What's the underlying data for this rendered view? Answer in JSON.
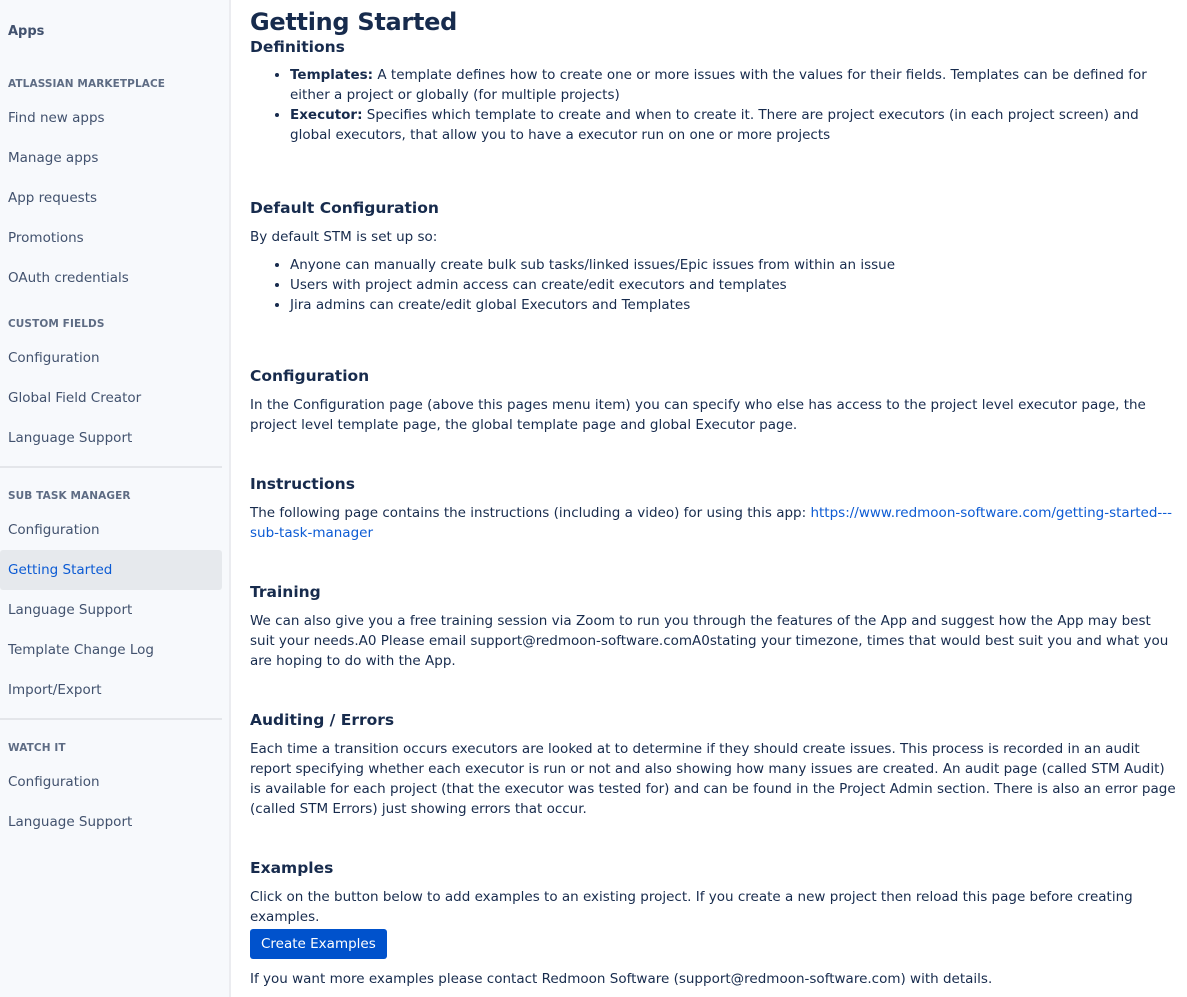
{
  "sidebar": {
    "title": "Apps",
    "groups": [
      {
        "heading": "ATLASSIAN MARKETPLACE",
        "items": [
          {
            "label": "Find new apps"
          },
          {
            "label": "Manage apps"
          },
          {
            "label": "App requests"
          },
          {
            "label": "Promotions"
          },
          {
            "label": "OAuth credentials"
          }
        ]
      },
      {
        "heading": "CUSTOM FIELDS",
        "items": [
          {
            "label": "Configuration"
          },
          {
            "label": "Global Field Creator"
          },
          {
            "label": "Language Support"
          }
        ]
      },
      {
        "heading": "SUB TASK MANAGER",
        "items": [
          {
            "label": "Configuration"
          },
          {
            "label": "Getting Started",
            "selected": true
          },
          {
            "label": "Language Support"
          },
          {
            "label": "Template Change Log"
          },
          {
            "label": "Import/Export"
          }
        ]
      },
      {
        "heading": "WATCH IT",
        "items": [
          {
            "label": "Configuration"
          },
          {
            "label": "Language Support"
          }
        ]
      }
    ]
  },
  "main": {
    "title": "Getting Started",
    "definitions": {
      "heading": "Definitions",
      "items": [
        {
          "term": "Templates:",
          "text": " A template defines how to create one or more issues with the values for their fields. Templates can be defined for either a project or globally (for multiple projects)"
        },
        {
          "term": "Executor:",
          "text": " Specifies which template to create and when to create it. There are project executors (in each project screen) and global executors, that allow you to have a executor run on one or more projects"
        }
      ]
    },
    "default_configuration": {
      "heading": "Default Configuration",
      "intro": "By default STM is set up so:",
      "items": [
        "Anyone can manually create bulk sub tasks/linked issues/Epic issues from within an issue",
        "Users with project admin access can create/edit executors and templates",
        "Jira admins can create/edit global Executors and Templates"
      ]
    },
    "configuration": {
      "heading": "Configuration",
      "text": "In the Configuration page (above this pages menu item) you can specify who else has access to the project level executor page, the project level template page, the global template page and global Executor page."
    },
    "instructions": {
      "heading": "Instructions",
      "text": "The following page contains the instructions (including a video) for using this app: ",
      "link": "https://www.redmoon-software.com/getting-started---sub-task-manager"
    },
    "training": {
      "heading": "Training",
      "text": "We can also give you a free training session via Zoom to run you through the features of the App and suggest how the App may best suit your needs.A0 Please email support@redmoon-software.comA0stating your timezone, times that would best suit you and what you are hoping to do with the App."
    },
    "auditing": {
      "heading": "Auditing / Errors",
      "text": "Each time a transition occurs executors are looked at to determine if they should create issues. This process is recorded in an audit report specifying whether each executor is run or not and also showing how many issues are created. An audit page (called STM Audit) is available for each project (that the executor was tested for) and can be found in the Project Admin section. There is also an error page (called STM Errors) just showing errors that occur."
    },
    "examples": {
      "heading": "Examples",
      "text": "Click on the button below to add examples to an existing project. If you create a new project then reload this page before creating examples.",
      "button_label": "Create Examples",
      "footer": "If you want more examples please contact Redmoon Software (support@redmoon-software.com) with details."
    }
  },
  "colors": {
    "sidebar_bg": "#f7f9fc",
    "selected_bg": "#e6e9ed",
    "accent": "#0052cc",
    "link": "#0c5bd4",
    "text": "#172b4d",
    "nav_text": "#42526e"
  }
}
